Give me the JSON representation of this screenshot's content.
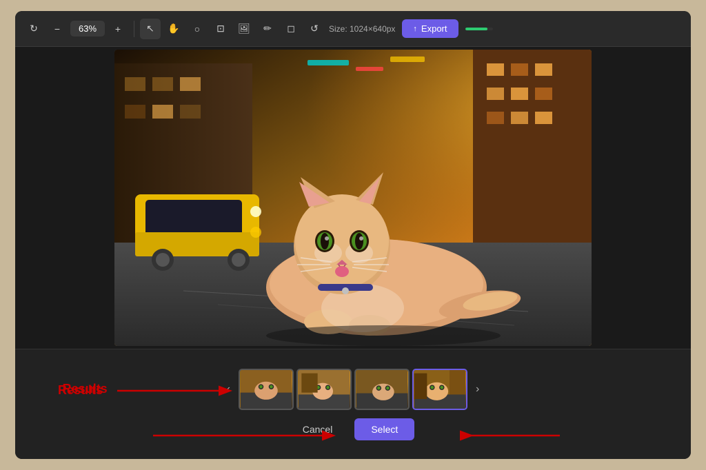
{
  "toolbar": {
    "zoom": "63%",
    "size_label": "Size: 1024×640px",
    "export_label": "Export",
    "redo_icon": "↻",
    "minus_icon": "−",
    "plus_icon": "+",
    "cursor_icon": "↖",
    "hand_icon": "✋",
    "circle_icon": "○",
    "crop_icon": "⊡",
    "image_icon": "🖼",
    "pen_icon": "✏",
    "eraser_icon": "◻",
    "undo_icon": "↺",
    "upload_icon": "↑"
  },
  "bottom": {
    "results_label": "Results",
    "cancel_label": "Cancel",
    "select_label": "Select",
    "nav_prev": "‹",
    "nav_next": "›",
    "thumbnails": [
      {
        "id": "thumb-1",
        "active": false
      },
      {
        "id": "thumb-2",
        "active": false
      },
      {
        "id": "thumb-3",
        "active": false
      },
      {
        "id": "thumb-4",
        "active": true
      }
    ]
  },
  "colors": {
    "accent": "#6c5ce7",
    "red_arrow": "#cc0000",
    "progress": "#2ecc71"
  }
}
